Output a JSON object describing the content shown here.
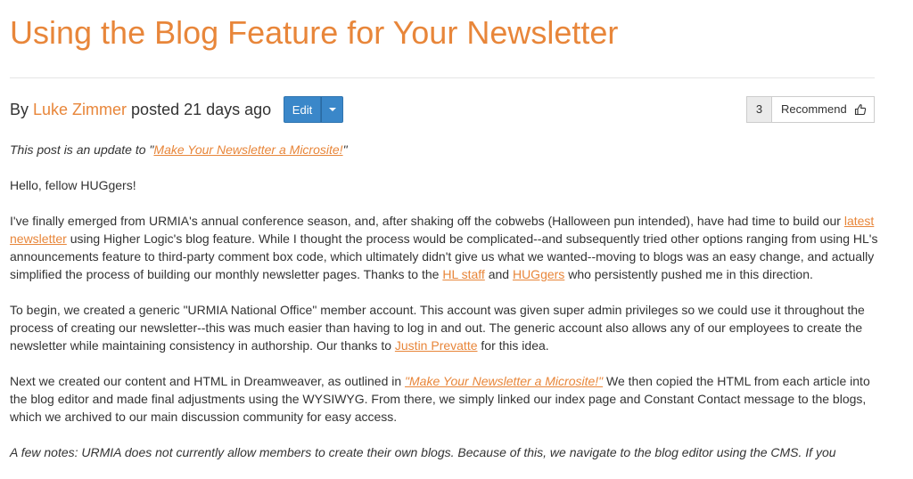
{
  "post": {
    "title": "Using the Blog Feature for Your Newsletter",
    "byline_prefix": "By ",
    "author": "Luke Zimmer",
    "posted": " posted 21 days ago"
  },
  "actions": {
    "edit_label": "Edit",
    "recommend_count": "3",
    "recommend_label": "Recommend"
  },
  "body": {
    "p1": {
      "text1": "This post is an update to \"",
      "link": "Make Your Newsletter a Microsite!",
      "text2": "\""
    },
    "p2": "Hello, fellow HUGgers!",
    "p3": {
      "text1": "I've finally emerged from URMIA's annual conference season, and, after shaking off the cobwebs (Halloween pun intended), have had time to build our ",
      "link1": "latest newsletter",
      "text2": " using Higher Logic's blog feature. While I thought the process would be complicated--and subsequently tried other options ranging from using HL's announcements feature to third-party comment box code, which ultimately didn't give us what we wanted--moving to blogs was an easy change, and actually simplified the process of building our monthly newsletter pages. Thanks to the ",
      "link2": "HL staff",
      "text3": " and ",
      "link3": "HUGgers",
      "text4": " who persistently pushed me in this direction."
    },
    "p4": {
      "text1": "To begin, we created a generic \"URMIA National Office\" member account. This account was given super admin privileges so we could use it throughout the process of creating our newsletter--this was much easier than having to log in and out. The generic account also allows any of our employees to create the newsletter while maintaining consistency in authorship. Our thanks to ",
      "link": "Justin Prevatte",
      "text2": " for this idea."
    },
    "p5": {
      "text1": "Next we created our content and HTML in Dreamweaver, as outlined in ",
      "link": "\"Make Your Newsletter a Microsite!\"",
      "text2": " We then copied the HTML from each article into the blog editor and made final adjustments using the WYSIWYG. From there, we simply linked our index page and Constant Contact message to the blogs, which we archived to our main discussion community for easy access."
    },
    "p6": "A few notes: URMIA does not currently allow members to create their own blogs. Because of this, we navigate to the blog editor using the CMS. If you"
  },
  "colors": {
    "accent": "#e8863a",
    "edit_button": "#3a87c9",
    "text": "#333333"
  },
  "icons": {
    "dropdown": "caret-down-icon",
    "recommend": "thumbs-up-icon"
  }
}
